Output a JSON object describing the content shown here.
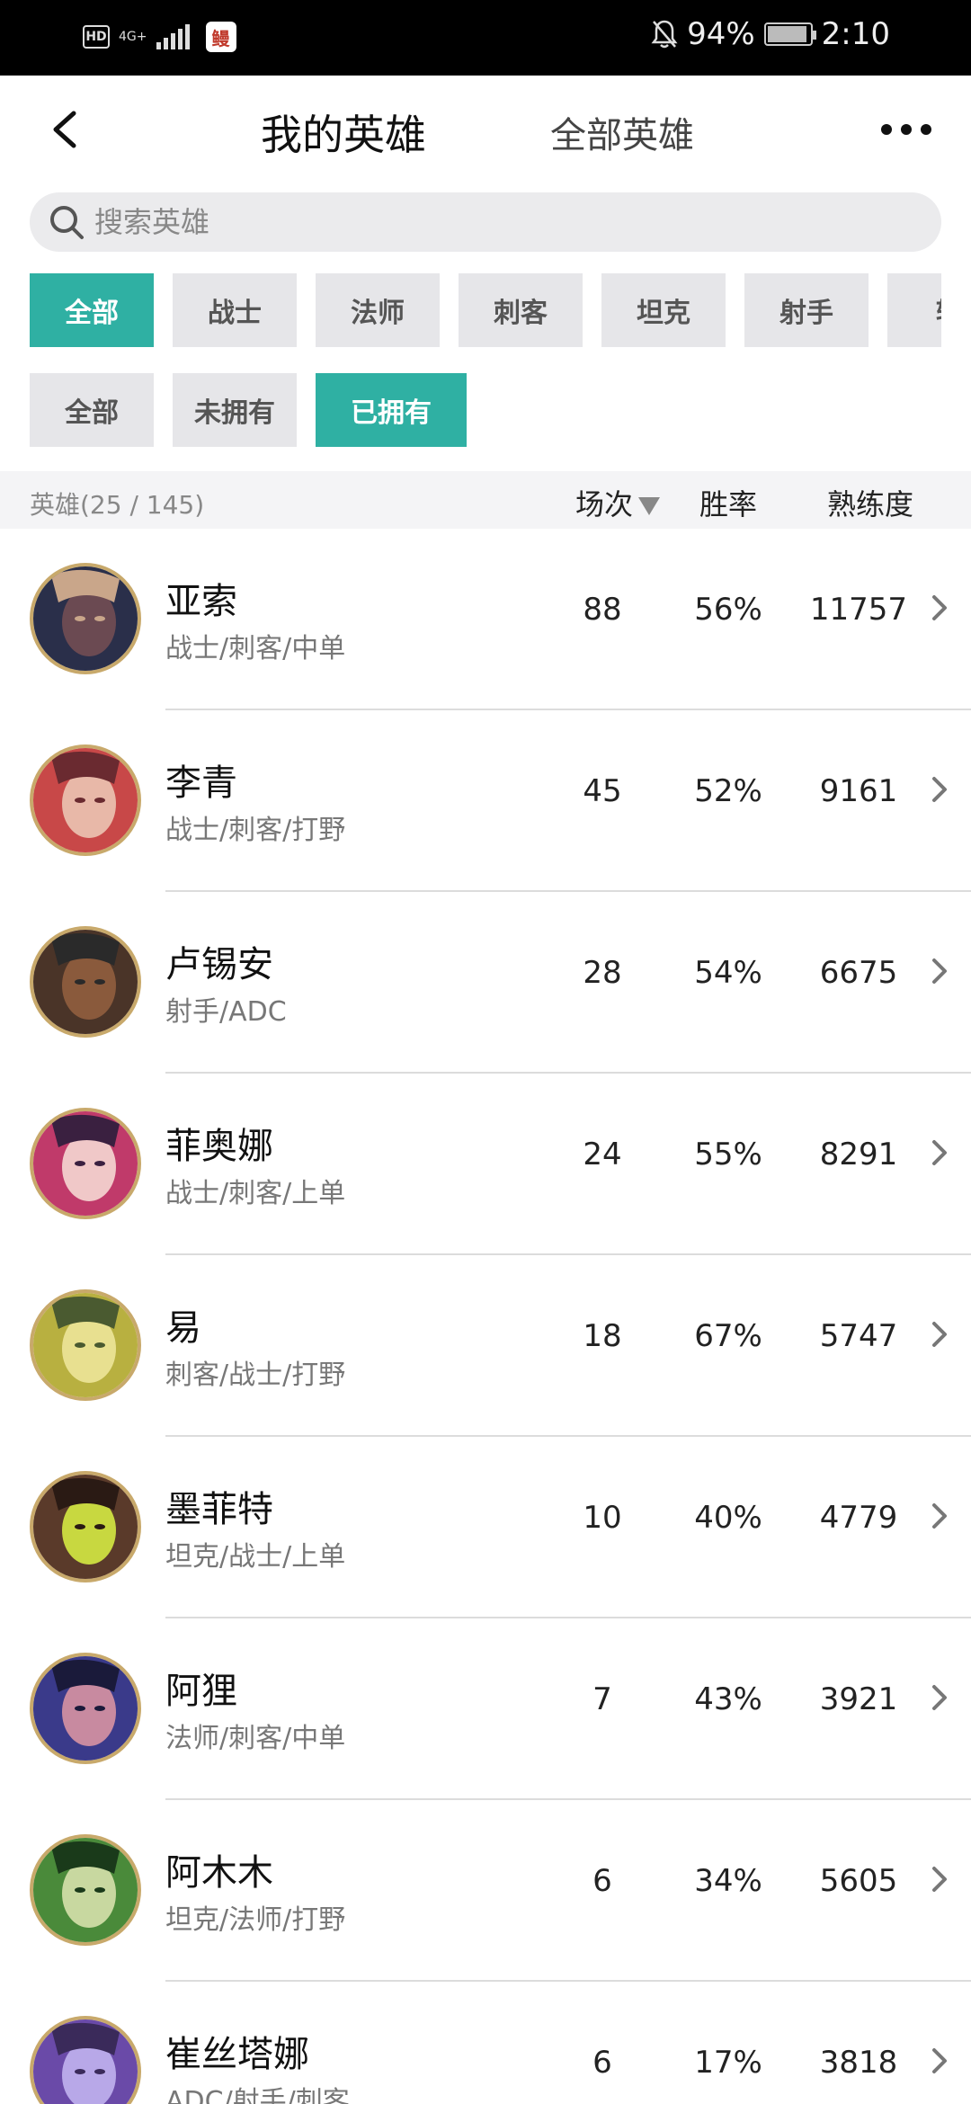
{
  "status_bar": {
    "hd": "HD",
    "network": "4G+",
    "app_badge": "鳗",
    "battery_percent": "94%",
    "battery_level": 0.94,
    "time": "2:10"
  },
  "header": {
    "title": "我的英雄",
    "other_tab": "全部英雄"
  },
  "search": {
    "placeholder": "搜索英雄"
  },
  "role_filters": [
    "全部",
    "战士",
    "法师",
    "刺客",
    "坦克",
    "射手",
    "辅"
  ],
  "role_active": "全部",
  "own_filters": [
    "全部",
    "未拥有",
    "已拥有"
  ],
  "own_active": "已拥有",
  "list_header": {
    "count": "英雄(25 / 145)",
    "games": "场次",
    "winrate": "胜率",
    "proficiency": "熟练度"
  },
  "heroes": [
    {
      "name": "亚索",
      "roles": "战士/刺客/中单",
      "games": "88",
      "winrate": "56%",
      "proficiency": "11757",
      "avatar_colors": [
        "#2a2f4a",
        "#6b4a52",
        "#c9a68a"
      ]
    },
    {
      "name": "李青",
      "roles": "战士/刺客/打野",
      "games": "45",
      "winrate": "52%",
      "proficiency": "9161",
      "avatar_colors": [
        "#c84848",
        "#e8b8a8",
        "#6a2a30"
      ]
    },
    {
      "name": "卢锡安",
      "roles": "射手/ADC",
      "games": "28",
      "winrate": "54%",
      "proficiency": "6675",
      "avatar_colors": [
        "#4a3428",
        "#8a5a3c",
        "#2a2a2a"
      ]
    },
    {
      "name": "菲奥娜",
      "roles": "战士/刺客/上单",
      "games": "24",
      "winrate": "55%",
      "proficiency": "8291",
      "avatar_colors": [
        "#c03a6a",
        "#f0c8c8",
        "#3a2040"
      ]
    },
    {
      "name": "易",
      "roles": "刺客/战士/打野",
      "games": "18",
      "winrate": "67%",
      "proficiency": "5747",
      "avatar_colors": [
        "#b8b040",
        "#e8e090",
        "#4a5a30"
      ]
    },
    {
      "name": "墨菲特",
      "roles": "坦克/战士/上单",
      "games": "10",
      "winrate": "40%",
      "proficiency": "4779",
      "avatar_colors": [
        "#5a3a2a",
        "#c8d840",
        "#2a1a14"
      ]
    },
    {
      "name": "阿狸",
      "roles": "法师/刺客/中单",
      "games": "7",
      "winrate": "43%",
      "proficiency": "3921",
      "avatar_colors": [
        "#3a3a8a",
        "#c88aa0",
        "#1a1a3a"
      ]
    },
    {
      "name": "阿木木",
      "roles": "坦克/法师/打野",
      "games": "6",
      "winrate": "34%",
      "proficiency": "5605",
      "avatar_colors": [
        "#4a8a3a",
        "#c8d8a0",
        "#1a3a1a"
      ]
    },
    {
      "name": "崔丝塔娜",
      "roles": "ADC/射手/刺客",
      "games": "6",
      "winrate": "17%",
      "proficiency": "3818",
      "avatar_colors": [
        "#6a4aa8",
        "#b8a8e8",
        "#3a2a5a"
      ]
    }
  ],
  "colors": {
    "accent": "#2fb0a3",
    "avatar_ring": "#c8a96b"
  }
}
